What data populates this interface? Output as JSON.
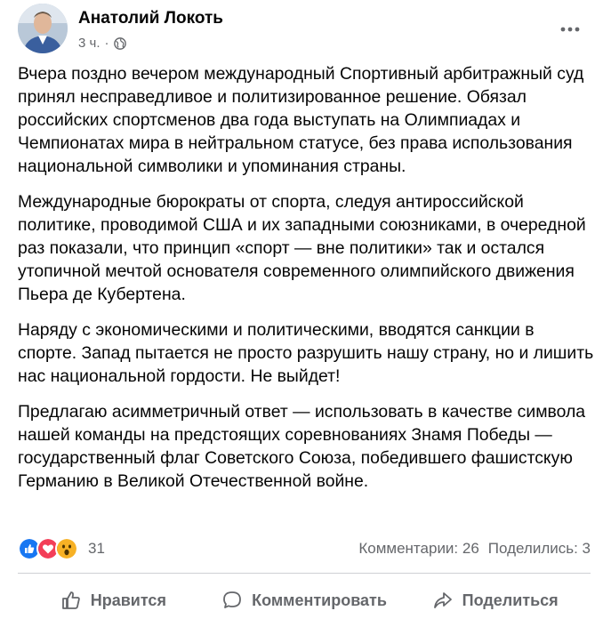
{
  "post": {
    "author": "Анатолий Локоть",
    "time": "3 ч.",
    "separator": "·",
    "paragraphs": [
      "Вчера поздно вечером международный Спортивный арбитражный суд принял несправедливое и политизированное решение. Обязал российских спортсменов два года выступать на Олимпиадах и Чемпионатах мира в нейтральном статусе, без права использования национальной символики и упоминания страны.",
      "Международные бюрократы от спорта, следуя  антироссийской политике, проводимой США и их западными союзниками, в очередной раз показали, что принцип «спорт — вне политики» так и остался утопичной мечтой основателя современного олимпийского движения Пьера де Кубертена.",
      "Наряду с экономическими и политическими, вводятся санкции в спорте.  Запад пытается не просто разрушить нашу страну, но и лишить нас национальной гордости. Не выйдет!",
      "Предлагаю асимметричный ответ — использовать в качестве символа нашей команды на предстоящих соревнованиях Знамя Победы — государственный флаг Советского Союза, победившего фашистскую Германию в Великой Отечественной войне."
    ]
  },
  "reactions": {
    "icons": [
      "like-reaction",
      "love-reaction",
      "wow-reaction"
    ],
    "count": "31",
    "comments": "Комментарии: 26",
    "shares": "Поделились: 3"
  },
  "actions": {
    "like": "Нравится",
    "comment": "Комментировать",
    "share": "Поделиться"
  },
  "colors": {
    "secondary_text": "#65676b",
    "like_blue": "#1877f2",
    "love_red": "#f33e58",
    "wow_yellow": "#f7b125"
  }
}
